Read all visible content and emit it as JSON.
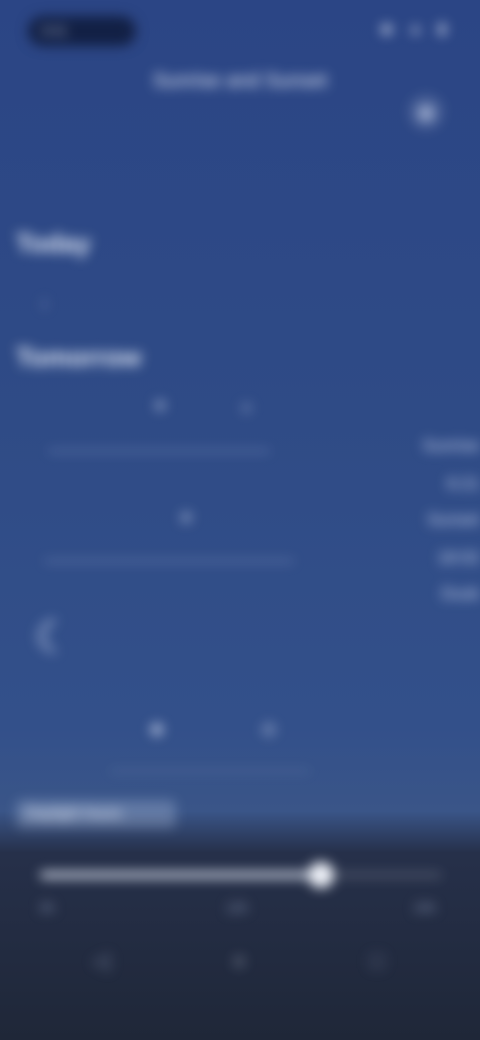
{
  "status_bar": {
    "time": "9:41",
    "icons": "◉ ▲ ▮"
  },
  "header": {
    "title": "Sunrise and Sunset",
    "action_icon": "calendar-icon"
  },
  "dates": {
    "from": "Today",
    "separator": "↓",
    "to": "Tomorrow"
  },
  "timeline": {
    "sun_icon_1": "☀",
    "sun_icon_2": "☼",
    "sun_icon_3": "☀",
    "right_labels": [
      "Sunrise",
      "6:21",
      "Sunset",
      "18:02",
      "Dusk"
    ]
  },
  "night": {
    "moon_icon": "☾",
    "star_1": "✦",
    "star_2": "✧"
  },
  "panel": {
    "title": "Daylight hours",
    "slider_value": 0.7,
    "slider_labels": [
      "0h",
      "12h",
      "24h"
    ]
  },
  "nav": {
    "back": "◁",
    "home": "○",
    "recents": "□"
  }
}
